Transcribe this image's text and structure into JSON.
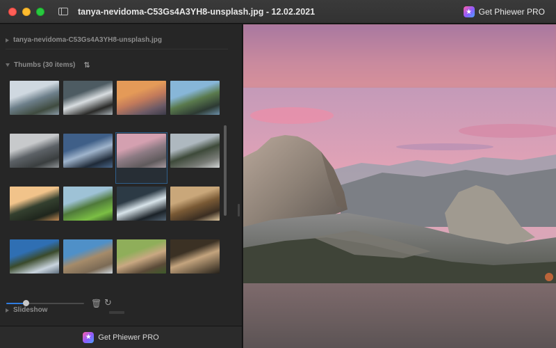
{
  "window": {
    "title": "tanya-nevidoma-C53Gs4A3YH8-unsplash.jpg - 12.02.2021",
    "pro_button_label": "Get Phiewer PRO"
  },
  "sidebar": {
    "file_section": {
      "label": "tanya-nevidoma-C53Gs4A3YH8-unsplash.jpg"
    },
    "thumbs_section": {
      "label": "Thumbs (30 items)"
    },
    "slideshow_section": {
      "label": "Slideshow"
    },
    "thumbnail_size_fraction": 0.25,
    "thumbnails": [
      {
        "subject": "river-canyon",
        "colors": [
          "#cfd8e0",
          "#6d7f8a",
          "#3f4b3f",
          "#8a9aa6"
        ]
      },
      {
        "subject": "snowy-rocks",
        "colors": [
          "#4d5b62",
          "#d8dde0",
          "#2a2a28",
          "#a7b0b5"
        ]
      },
      {
        "subject": "sunset-clouds",
        "colors": [
          "#e49a58",
          "#c27a5b",
          "#6c5a66",
          "#3b3a48"
        ]
      },
      {
        "subject": "lake-reflection",
        "colors": [
          "#87b6d8",
          "#5a7a4d",
          "#2d3a33",
          "#6b8fa8"
        ]
      },
      {
        "subject": "cloudy-valley",
        "colors": [
          "#c7c9cb",
          "#5c6166",
          "#3a3e3f",
          "#8e9295"
        ]
      },
      {
        "subject": "mirror-lake-night",
        "colors": [
          "#3f5f88",
          "#9fb4cc",
          "#1f2a38",
          "#4a6688"
        ]
      },
      {
        "subject": "half-dome-dusk",
        "colors": [
          "#d4a0b0",
          "#8d7b84",
          "#5f5a5c",
          "#a89aa0"
        ]
      },
      {
        "subject": "forest-road",
        "colors": [
          "#aeb8bf",
          "#3e4a3a",
          "#7a7d78",
          "#d3d6d6"
        ]
      },
      {
        "subject": "sun-through-trees",
        "colors": [
          "#f1c38a",
          "#34402f",
          "#1f261d",
          "#c08a54"
        ]
      },
      {
        "subject": "green-meadow",
        "colors": [
          "#9ec2d6",
          "#4f7a3a",
          "#7bbf44",
          "#2e4d24"
        ]
      },
      {
        "subject": "waterfall-stream",
        "colors": [
          "#2c3a45",
          "#d8e4ea",
          "#1b2228",
          "#536372"
        ]
      },
      {
        "subject": "autumn-forest",
        "colors": [
          "#c9a77a",
          "#7a5a35",
          "#3b2e22",
          "#e0c8a0"
        ]
      },
      {
        "subject": "pine-valley-vista",
        "colors": [
          "#2f6fb3",
          "#3a4a2b",
          "#c9d4de",
          "#5e6e7c"
        ]
      },
      {
        "subject": "rocky-overlook",
        "colors": [
          "#4f90c8",
          "#a58b6a",
          "#7b6a55",
          "#cfd7de"
        ]
      },
      {
        "subject": "squirrel",
        "colors": [
          "#8fae5a",
          "#c9a882",
          "#5a4a38",
          "#3d5a2a"
        ]
      },
      {
        "subject": "chipmunk",
        "colors": [
          "#3b3124",
          "#c4a47e",
          "#6b5a44",
          "#24201a"
        ]
      }
    ],
    "selected_index": 6
  },
  "footer": {
    "pro_button_label": "Get Phiewer PRO"
  },
  "viewer": {
    "image_subject": "half-dome-pink-sunset",
    "colors": {
      "sky_top": "#b99ab8",
      "sky_pink": "#e7a0b4",
      "cloud": "#e98ba8",
      "rock": "#7a726d",
      "forest": "#3c4236"
    }
  },
  "colors": {
    "accent": "#2f7de1",
    "selection": "#2f5f8c"
  }
}
